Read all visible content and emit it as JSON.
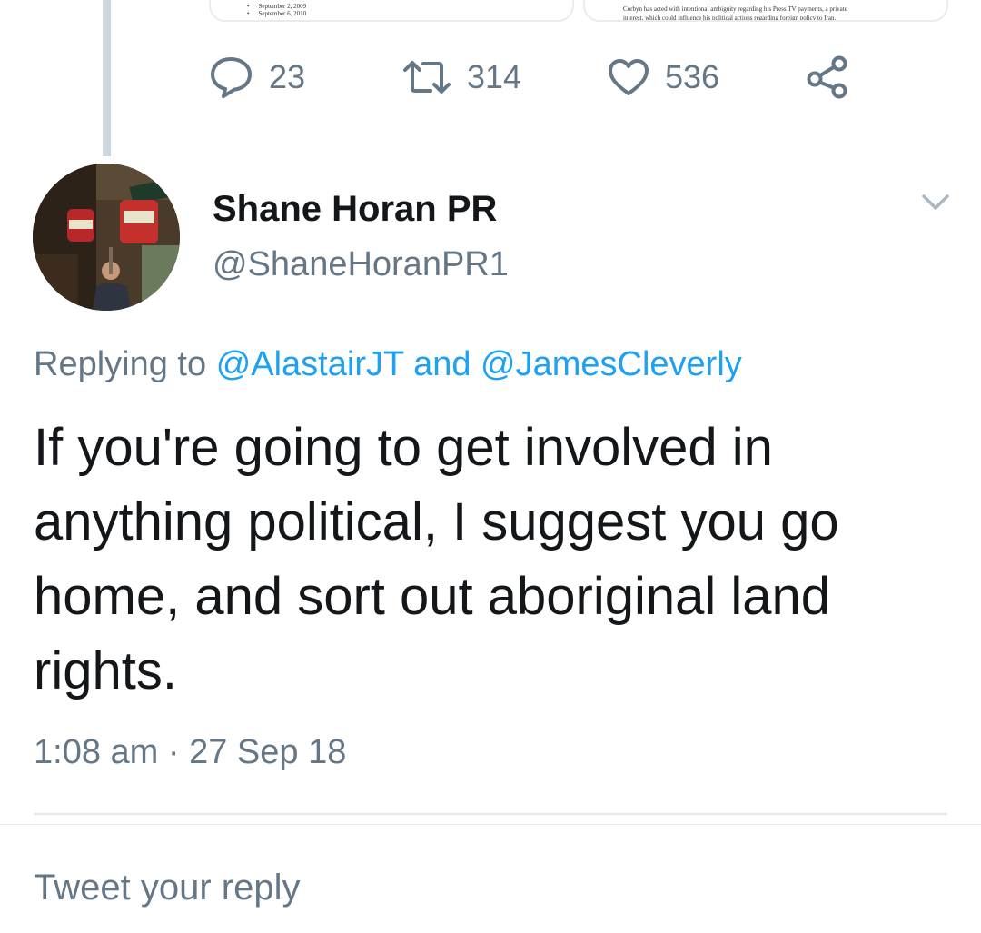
{
  "embedded_cards": {
    "left": {
      "lines": [
        "September 2, 2009",
        "September 6, 2010"
      ]
    },
    "right": {
      "lines": [
        "Corbyn has acted with intentional ambiguity regarding his Press TV payments, a private",
        "interest, which could influence his political actions regarding foreign policy to Iran."
      ]
    }
  },
  "actions": {
    "reply_count": "23",
    "retweet_count": "314",
    "like_count": "536"
  },
  "author": {
    "display_name": "Shane Horan PR",
    "handle": "@ShaneHoranPR1"
  },
  "replying": {
    "prefix": "Replying to",
    "mention_1": "@AlastairJT",
    "joiner": "and",
    "mention_2": "@JamesCleverly"
  },
  "tweet": {
    "text": "If you're going to get involved in anything political, I suggest you go home, and sort out aboriginal land rights.",
    "timestamp": "1:08 am · 27 Sep 18"
  },
  "composer": {
    "placeholder": "Tweet your reply"
  },
  "colors": {
    "link": "#1da1f2",
    "secondary_text": "#657786",
    "thread_line": "#ccd6dd"
  }
}
